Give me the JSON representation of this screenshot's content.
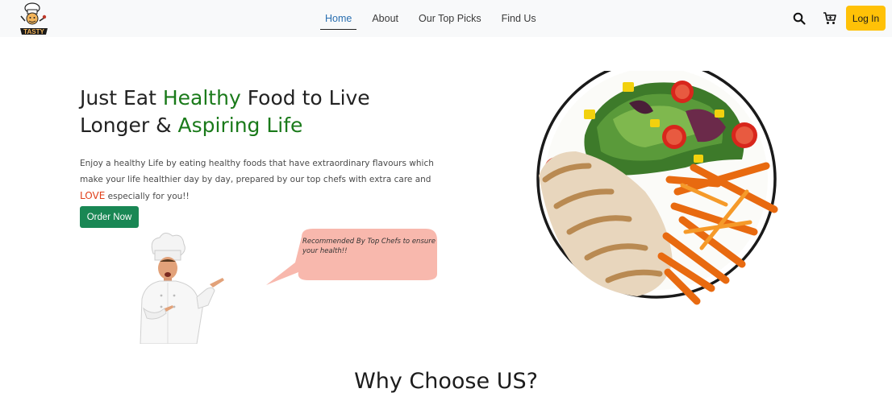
{
  "nav": {
    "logo_text": "TASTY",
    "links": [
      {
        "label": "Home",
        "active": true
      },
      {
        "label": "About",
        "active": false
      },
      {
        "label": "Our Top Picks",
        "active": false
      },
      {
        "label": "Find Us",
        "active": false
      }
    ],
    "login_label": "Log In",
    "search_icon": "search-icon",
    "cart_icon": "cart-icon"
  },
  "hero": {
    "title_part1": "Just Eat ",
    "title_highlight1": "Healthy",
    "title_part2": " Food to Live Longer & ",
    "title_highlight2": "Aspiring Life",
    "description_part1": "Enjoy a healthy Life by eating healthy foods that have extraordinary flavours which make your life healthier day by day, prepared by our top chefs with extra care and ",
    "description_highlight": "LOVE",
    "description_part2": " especially for you!!",
    "order_button_label": "Order Now",
    "bubble_text": "Recommended By Top Chefs to ensure your health!!"
  },
  "section": {
    "title": "Why Choose US?"
  },
  "colors": {
    "accent_green": "#1a7a1a",
    "button_green": "#198754",
    "login_yellow": "#ffc107",
    "bubble_pink": "#f8b8ad",
    "love_red": "#e0401a"
  }
}
